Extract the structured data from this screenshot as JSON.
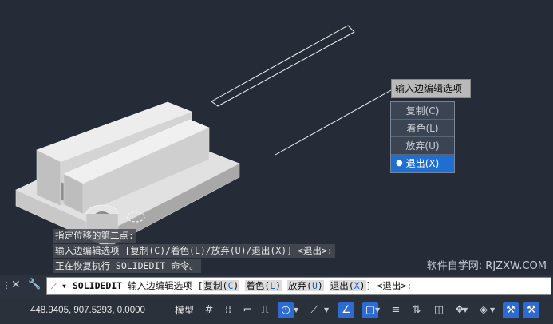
{
  "viewport": {
    "popup": {
      "title": "输入边编辑选项",
      "items": [
        {
          "label": "复制(C)",
          "active": false
        },
        {
          "label": "着色(L)",
          "active": false
        },
        {
          "label": "放弃(U)",
          "active": false
        },
        {
          "label": "退出(X)",
          "active": true
        }
      ],
      "bullet": "●"
    },
    "history": [
      "指定位移的第二点:",
      "输入边编辑选项 [复制(C)/着色(L)/放弃(U)/退出(X)] <退出>:",
      "正在恢复执行 SOLIDEDIT 命令。"
    ],
    "watermark": "软件自学网: RJZXW.COM"
  },
  "command_line": {
    "close_glyph": "✕",
    "wrench_glyph": "🔧",
    "tool_glyph": "⟋",
    "dropdown_glyph": "▾",
    "command": "SOLIDEDIT",
    "prompt": "输入边编辑选项",
    "bracket_open": "[",
    "bracket_close": "]",
    "options": [
      {
        "pre": "复制(",
        "key": "C",
        "post": ")"
      },
      {
        "pre": "着色(",
        "key": "L",
        "post": ")"
      },
      {
        "pre": "放弃(",
        "key": "U",
        "post": ")"
      },
      {
        "pre": "退出(",
        "key": "X",
        "post": ")"
      }
    ],
    "default": "<退出>:"
  },
  "status_bar": {
    "coordinates": "448.9405, 907.5293, 0.0000",
    "model_label": "模型",
    "icons": [
      {
        "name": "grid-icon",
        "glyph": "#",
        "on": false
      },
      {
        "name": "snap-icon",
        "glyph": "⁞⁞",
        "on": false
      },
      {
        "name": "infer-icon",
        "glyph": "⌐",
        "on": false
      },
      {
        "name": "dynamic-ucs-icon",
        "glyph": "⎍",
        "on": false
      },
      {
        "name": "polar-tracking-icon",
        "glyph": "◴",
        "on": true
      },
      {
        "name": "isodraft-icon",
        "glyph": "⟋",
        "on": false
      },
      {
        "name": "object-snap-tracking-icon",
        "glyph": "∠",
        "on": true
      },
      {
        "name": "object-snap-icon",
        "glyph": "▢",
        "on": true
      },
      {
        "name": "lineweight-icon",
        "glyph": "≡",
        "on": false
      },
      {
        "name": "selection-cycling-icon",
        "glyph": "⇅",
        "on": false
      },
      {
        "name": "transparency-icon",
        "glyph": "◫",
        "on": false
      },
      {
        "name": "gizmo-icon",
        "glyph": "✥",
        "on": false
      },
      {
        "name": "3d-object-snap-icon",
        "glyph": "◈",
        "on": false
      },
      {
        "name": "annotation-visibility-icon",
        "glyph": "⚒",
        "on": true
      },
      {
        "name": "annotation-scale-icon",
        "glyph": "⚒",
        "on": true
      }
    ]
  },
  "colors": {
    "canvas": "#252c38",
    "highlight": "#1f6fd2",
    "solid_face_light": "#e2e2e2",
    "solid_face_mid": "#c4c4c4",
    "solid_face_dark": "#9c9c9c"
  }
}
